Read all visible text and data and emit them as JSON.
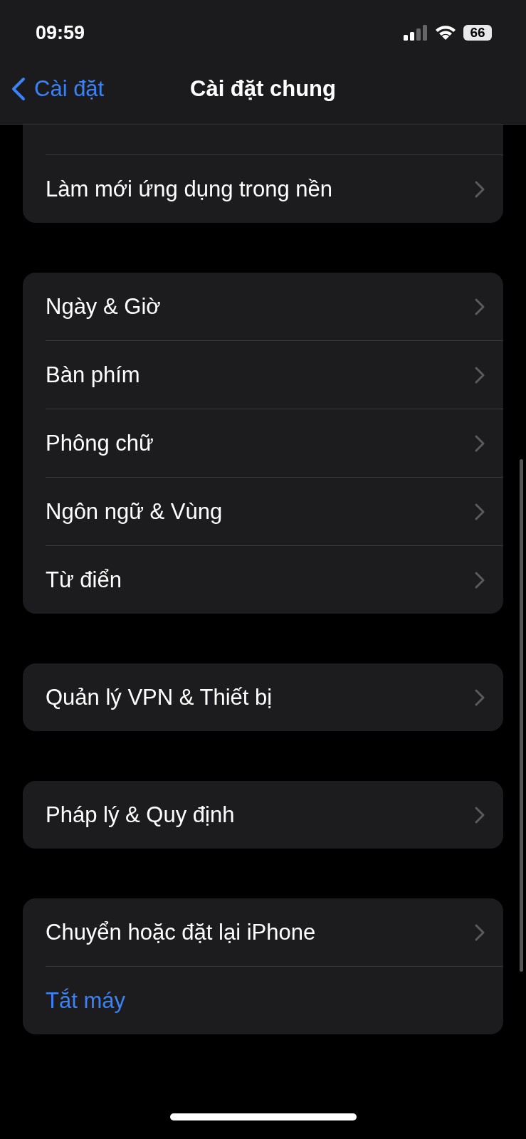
{
  "status_bar": {
    "time": "09:59",
    "battery": "66"
  },
  "nav_bar": {
    "back": "Cài đặt",
    "title": "Cài đặt chung"
  },
  "groups": [
    {
      "clipped_top": true,
      "rows": [
        {
          "label": "Làm mới ứng dụng trong nền",
          "kind": "nav"
        }
      ]
    },
    {
      "rows": [
        {
          "label": "Ngày & Giờ",
          "kind": "nav"
        },
        {
          "label": "Bàn phím",
          "kind": "nav"
        },
        {
          "label": "Phông chữ",
          "kind": "nav"
        },
        {
          "label": "Ngôn ngữ & Vùng",
          "kind": "nav"
        },
        {
          "label": "Từ điển",
          "kind": "nav"
        }
      ]
    },
    {
      "rows": [
        {
          "label": "Quản lý VPN & Thiết bị",
          "kind": "nav"
        }
      ]
    },
    {
      "rows": [
        {
          "label": "Pháp lý & Quy định",
          "kind": "nav"
        }
      ]
    },
    {
      "rows": [
        {
          "label": "Chuyển hoặc đặt lại iPhone",
          "kind": "nav"
        },
        {
          "label": "Tắt máy",
          "kind": "action"
        }
      ]
    }
  ]
}
